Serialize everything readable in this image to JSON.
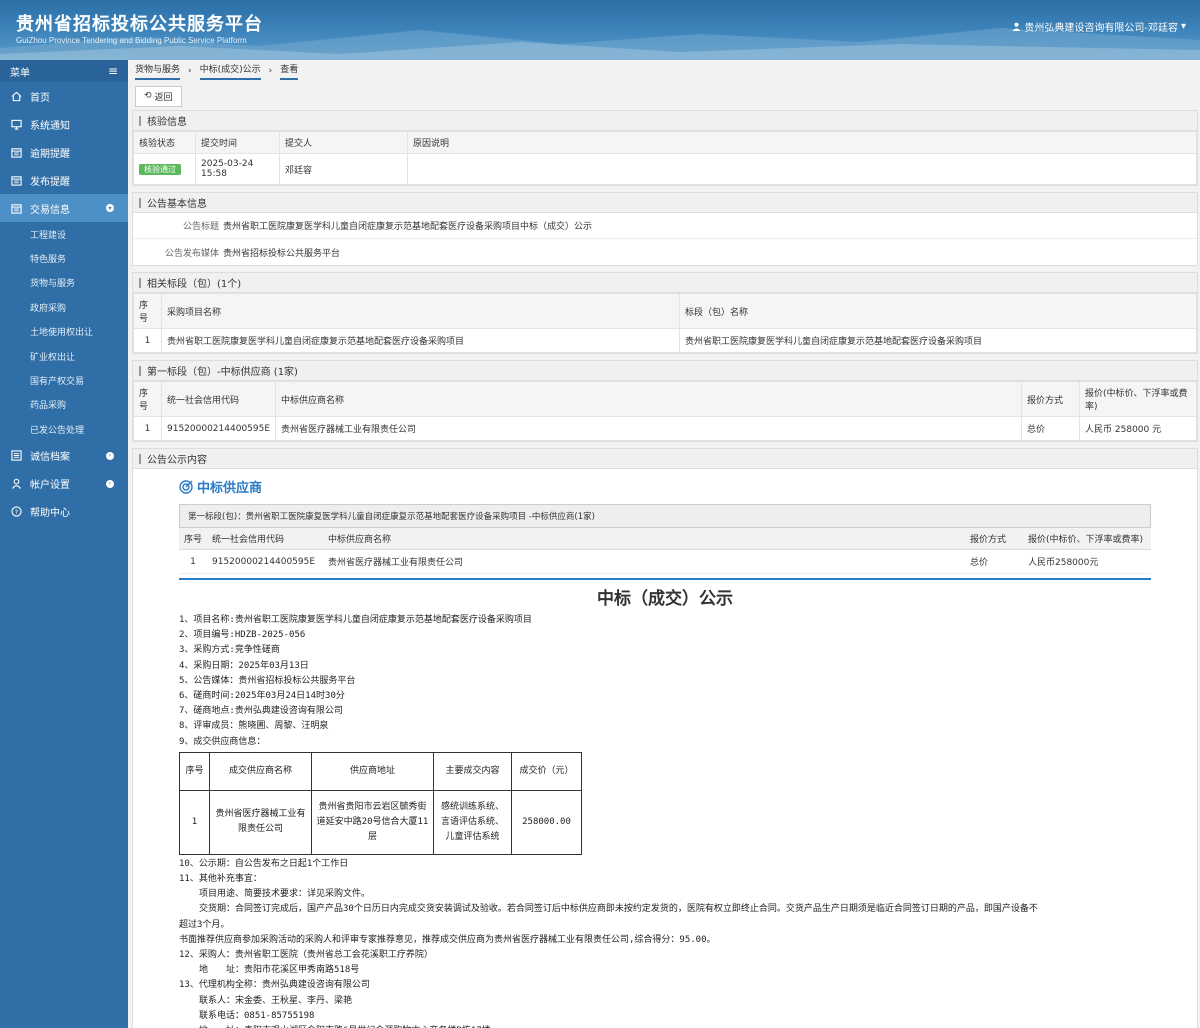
{
  "header": {
    "title": "贵州省招标投标公共服务平台",
    "subtitle": "GuiZhou Province Tendering and Bidding Public Service Platform",
    "user": "贵州弘典建设咨询有限公司-邓廷容"
  },
  "sidebar": {
    "menu_label": "菜单",
    "items": [
      {
        "label": "首页",
        "icon": "home-icon"
      },
      {
        "label": "系统通知",
        "icon": "monitor-icon"
      },
      {
        "label": "逾期提醒",
        "icon": "calendar-icon"
      },
      {
        "label": "发布提醒",
        "icon": "calendar-icon"
      },
      {
        "label": "交易信息",
        "icon": "calendar-icon"
      }
    ],
    "sub_items": [
      "工程建设",
      "特色服务",
      "货物与服务",
      "政府采购",
      "土地使用权出让",
      "矿业权出让",
      "国有产权交易",
      "药品采购",
      "已发公告处理"
    ],
    "bottom_items": [
      {
        "label": "诚信档案",
        "icon": "list-icon"
      },
      {
        "label": "帐户设置",
        "icon": "user-icon"
      },
      {
        "label": "帮助中心",
        "icon": "help-icon"
      }
    ]
  },
  "breadcrumb": [
    "货物与服务",
    "中标(成交)公示",
    "查看"
  ],
  "toolbar": {
    "back_label": "返回"
  },
  "verify": {
    "title": "核验信息",
    "headers": [
      "核验状态",
      "提交时间",
      "提交人",
      "原因说明"
    ],
    "row": {
      "status": "核验通过",
      "time": "2025-03-24 15:58",
      "submitter": "邓廷容",
      "reason": ""
    }
  },
  "basic": {
    "title": "公告基本信息",
    "notice_title_label": "公告标题",
    "notice_title": "贵州省职工医院康复医学科儿童自闭症康复示范基地配套医疗设备采购项目中标（成交）公示",
    "media_label": "公告发布媒体",
    "media": "贵州省招标投标公共服务平台"
  },
  "sections": {
    "title": "相关标段（包）(1个)",
    "headers": [
      "序号",
      "采购项目名称",
      "标段（包）名称"
    ],
    "rows": [
      {
        "no": "1",
        "project": "贵州省职工医院康复医学科儿童自闭症康复示范基地配套医疗设备采购项目",
        "section": "贵州省职工医院康复医学科儿童自闭症康复示范基地配套医疗设备采购项目"
      }
    ]
  },
  "winner": {
    "title": "第一标段（包）-中标供应商 (1家)",
    "headers": [
      "序号",
      "统一社会信用代码",
      "中标供应商名称",
      "报价方式",
      "报价(中标价、下浮率或费率)"
    ],
    "rows": [
      {
        "no": "1",
        "code": "91520000214400595E",
        "name": "贵州省医疗器械工业有限责任公司",
        "mode": "总价",
        "price": "人民币 258000 元"
      }
    ]
  },
  "announcement": {
    "title": "公告公示内容",
    "head": "中标供应商",
    "section_label": "第一标段(包)：贵州省职工医院康复医学科儿童自闭症康复示范基地配套医疗设备采购项目 -中标供应商(1家)",
    "headers": [
      "序号",
      "统一社会信用代码",
      "中标供应商名称",
      "报价方式",
      "报价(中标价、下浮率或费率)"
    ],
    "row": {
      "no": "1",
      "code": "91520000214400595E",
      "name": "贵州省医疗器械工业有限责任公司",
      "mode": "总价",
      "price": "人民币258000元"
    },
    "doc_title": "中标（成交）公示",
    "lines_a": [
      "1、项目名称:贵州省职工医院康复医学科儿童自闭症康复示范基地配套医疗设备采购项目",
      "2、项目编号:HDZB-2025-056",
      "3、采购方式:竞争性磋商",
      "4、采购日期：2025年03月13日",
      "5、公告媒体：贵州省招标投标公共服务平台",
      "6、磋商时间:2025年03月24日14时30分",
      "7、磋商地点:贵州弘典建设咨询有限公司",
      "8、评审成员：熊晓圃、周黎、汪明泉",
      "9、成交供应商信息："
    ],
    "sup_headers": [
      "序号",
      "成交供应商名称",
      "供应商地址",
      "主要成交内容",
      "成交价（元）"
    ],
    "sup_row": {
      "no": "1",
      "name": "贵州省医疗器械工业有限责任公司",
      "addr": "贵州省贵阳市云岩区毓秀街道延安中路20号信合大厦11层",
      "content": "感统训练系统、言语评估系统、儿童评估系统",
      "price": "258000.00"
    },
    "lines_b": [
      "10、公示期：自公告发布之日起1个工作日",
      "11、其他补充事宜："
    ],
    "lines_ind": [
      "项目用途、简要技术要求：详见采购文件。",
      "交货期：合同签订完成后，国产产品30个日历日内完成交货安装调试及验收。若合同签订后中标供应商即未按约定发货的，医院有权立即终止合同。交货产品生产日期须是临近合同签订日期的产品，即国产设备不"
    ],
    "line_cont": "超过3个月。",
    "line_rec": "书面推荐供应商参加采购活动的采购人和评审专家推荐意见，推荐成交供应商为贵州省医疗器械工业有限责任公司,综合得分：95.00。",
    "lines_c": [
      "12、采购人：贵州省职工医院（贵州省总工会花溪职工疗养院）"
    ],
    "lines_c_ind": [
      "地　　址：贵阳市花溪区甲秀南路518号"
    ],
    "lines_d": [
      "13、代理机构全称：贵州弘典建设咨询有限公司"
    ],
    "lines_d_ind": [
      "联系人：宋金委、王秋星、李丹、梁艳",
      "联系电话：0851-85755198",
      "地　　址：贵阳市观山湖区金阳南路6号世纪金源购物中心商务楼B栋17楼"
    ]
  },
  "colors": {
    "sidebar": "#2f6ea6",
    "accent": "#2b7cc7",
    "badge": "#5cb85c"
  }
}
